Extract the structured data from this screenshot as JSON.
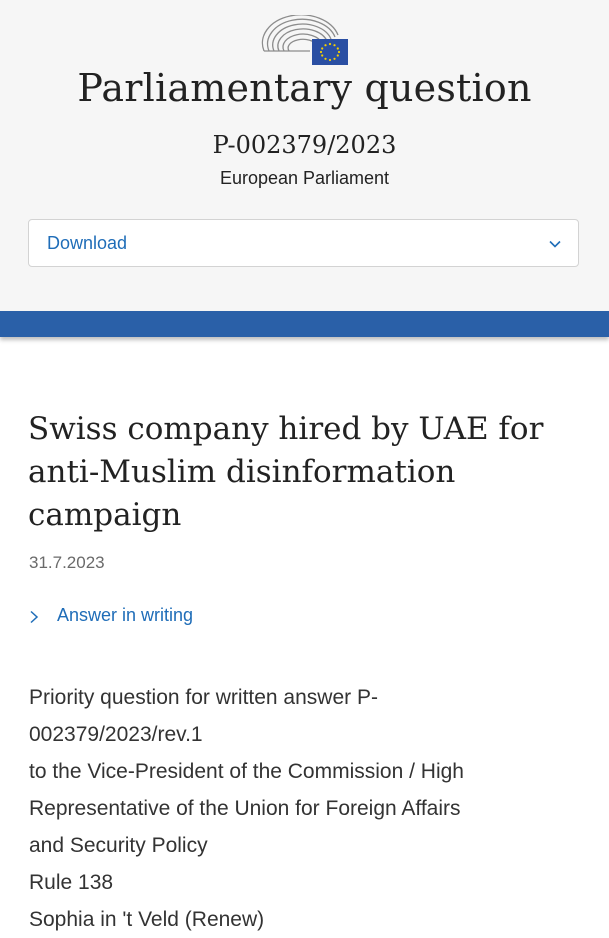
{
  "header": {
    "title": "Parliamentary question",
    "reference": "P-002379/2023",
    "organization": "European Parliament",
    "logo_icon": "european-parliament-logo",
    "eu_flag_color": "#2a4fa3",
    "eu_stars_color": "#f5d000"
  },
  "download": {
    "label": "Download",
    "icon": "chevron-down-icon"
  },
  "accent_color": "#2a60a8",
  "link_color": "#1f6db8",
  "question": {
    "title": "Swiss company hired by UAE for anti-Muslim disinformation campaign",
    "date": "31.7.2023",
    "answer_link": "Answer in writing",
    "answer_icon": "chevron-right-icon"
  },
  "meta": {
    "lines": [
      "Priority question for written answer  P-",
      "002379/2023/rev.1",
      "to the Vice-President of the Commission / High",
      "Representative of the Union for Foreign Affairs",
      "and Security Policy",
      "Rule 138",
      "Sophia in 't Veld (Renew)"
    ]
  }
}
